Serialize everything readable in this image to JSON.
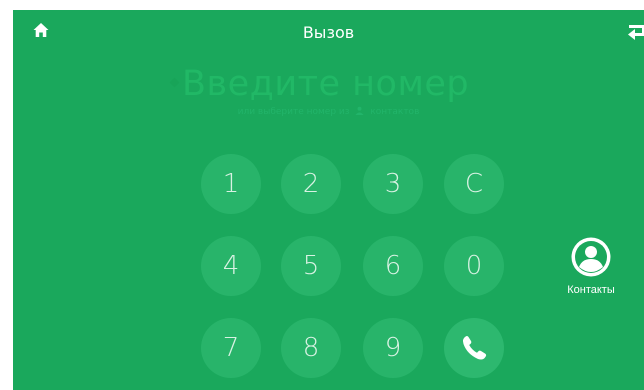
{
  "header": {
    "title": "Вызов",
    "home_icon": "home-icon",
    "back_icon": "back-arrow-icon"
  },
  "number_input": {
    "placeholder": "Введите номер",
    "hint_before": "или выберите номер из",
    "hint_icon": "phone-book-icon",
    "hint_after": "контактов"
  },
  "keypad": {
    "keys": [
      "1",
      "2",
      "3",
      "C",
      "4",
      "5",
      "6",
      "0",
      "7",
      "8",
      "9"
    ],
    "call_icon": "phone-handset-icon"
  },
  "contacts": {
    "label": "Контакты",
    "icon": "contact-person-icon"
  },
  "colors": {
    "background": "#1aa85c",
    "key_fill": "#28b46a",
    "key_text": "#d8f2e3",
    "text": "#ffffff"
  }
}
